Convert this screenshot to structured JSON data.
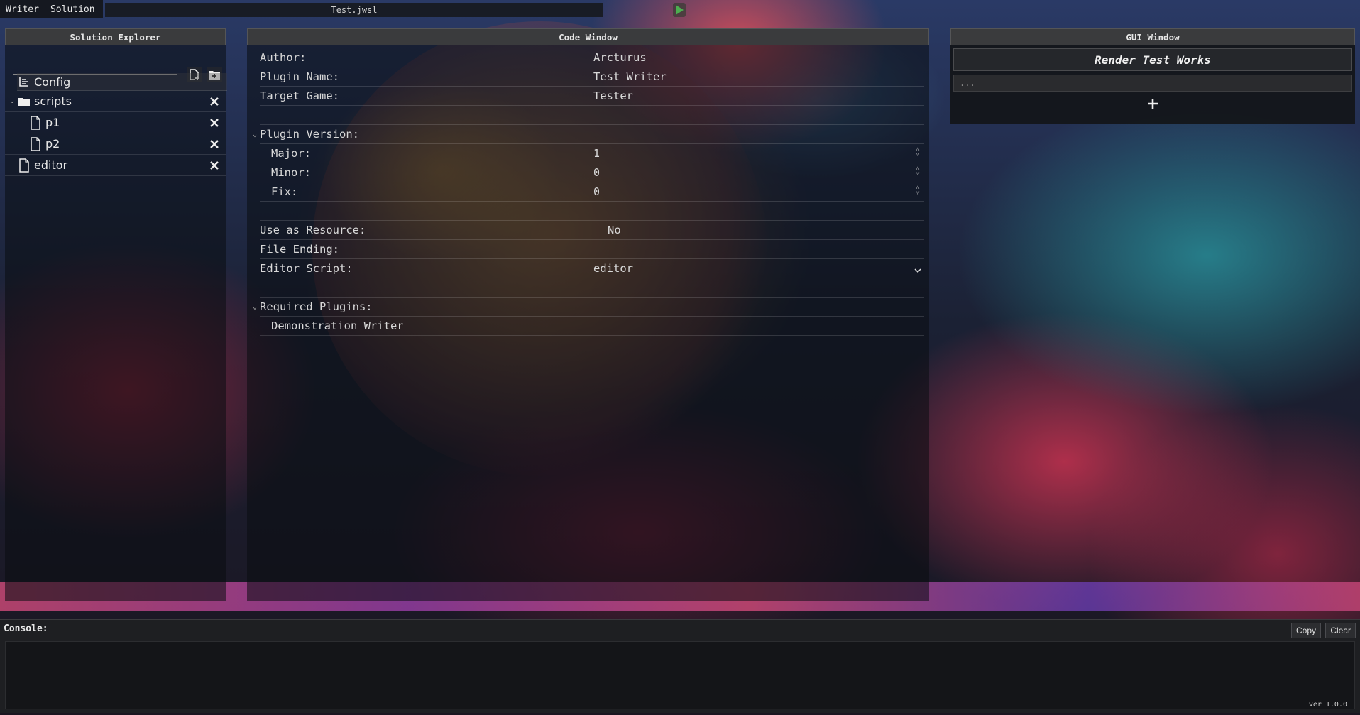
{
  "menu": {
    "writer": "Writer",
    "solution": "Solution"
  },
  "window_title": "Test.jwsl",
  "solution_explorer": {
    "header": "Solution Explorer",
    "items": [
      {
        "label": "Config"
      },
      {
        "label": "scripts"
      },
      {
        "label": "p1"
      },
      {
        "label": "p2"
      },
      {
        "label": "editor"
      }
    ]
  },
  "code_window": {
    "header": "Code Window",
    "author_label": "Author:",
    "author_value": "Arcturus",
    "plugin_name_label": "Plugin Name:",
    "plugin_name_value": "Test Writer",
    "target_game_label": "Target Game:",
    "target_game_value": "Tester",
    "plugin_version_label": "Plugin Version:",
    "major_label": "Major:",
    "major_value": "1",
    "minor_label": "Minor:",
    "minor_value": "0",
    "fix_label": "Fix:",
    "fix_value": "0",
    "use_as_resource_label": "Use as Resource:",
    "use_as_resource_value": "No",
    "file_ending_label": "File Ending:",
    "editor_script_label": "Editor Script:",
    "editor_script_value": "editor",
    "required_plugins_label": "Required Plugins:",
    "required_plugins": [
      "Demonstration Writer"
    ]
  },
  "gui_window": {
    "header": "GUI Window",
    "title": "Render Test Works",
    "input_value": "..."
  },
  "console": {
    "label": "Console:",
    "copy_label": "Copy",
    "clear_label": "Clear",
    "version": "ver 1.0.0"
  },
  "colors": {
    "play_green": "#4caf50",
    "panel_header": "#3a3b3d"
  }
}
